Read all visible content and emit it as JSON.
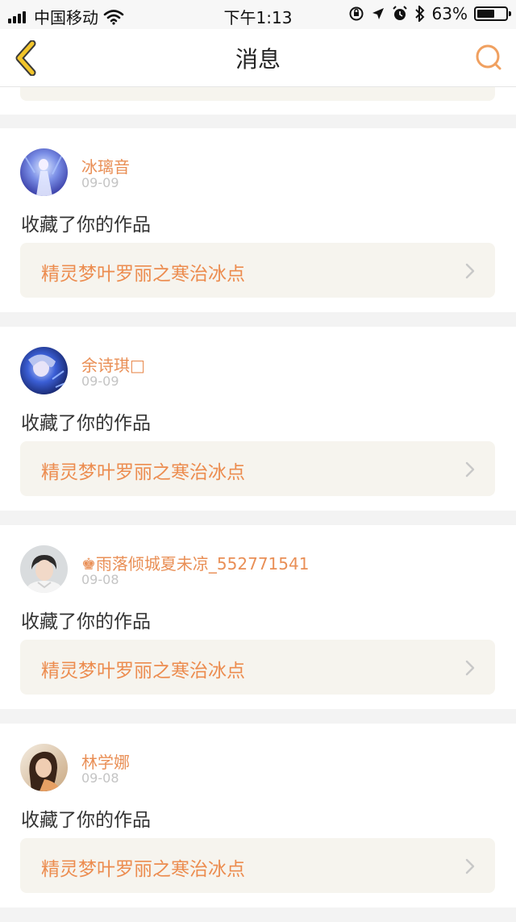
{
  "status_bar": {
    "carrier": "中国移动",
    "time": "下午1:13",
    "battery": "63%",
    "battery_level": 0.63,
    "icons": [
      "signal-icon",
      "wifi-icon",
      "orientation-lock-icon",
      "location-icon",
      "alarm-icon",
      "bluetooth-icon",
      "battery-icon"
    ]
  },
  "nav": {
    "title": "消息",
    "back_icon": "chevron-left-icon",
    "search_icon": "search-icon",
    "accent": "#f2c52b"
  },
  "messages": [
    {
      "username": "冰璃音",
      "date": "09-09",
      "action": "收藏了你的作品",
      "work": "精灵梦叶罗丽之寒治冰点",
      "avatar": "avatar-1"
    },
    {
      "username": "余诗琪□",
      "date": "09-09",
      "action": "收藏了你的作品",
      "work": "精灵梦叶罗丽之寒治冰点",
      "avatar": "avatar-2"
    },
    {
      "username": "♚雨落倾城夏未凉_552771541",
      "date": "09-08",
      "action": "收藏了你的作品",
      "work": "精灵梦叶罗丽之寒治冰点",
      "avatar": "avatar-3"
    },
    {
      "username": "林学娜",
      "date": "09-08",
      "action": "收藏了你的作品",
      "work": "精灵梦叶罗丽之寒治冰点",
      "avatar": "avatar-4"
    }
  ],
  "colors": {
    "username": "#e98f56",
    "work_title": "#ec8c4f",
    "link_bg": "#f6f4ee"
  }
}
